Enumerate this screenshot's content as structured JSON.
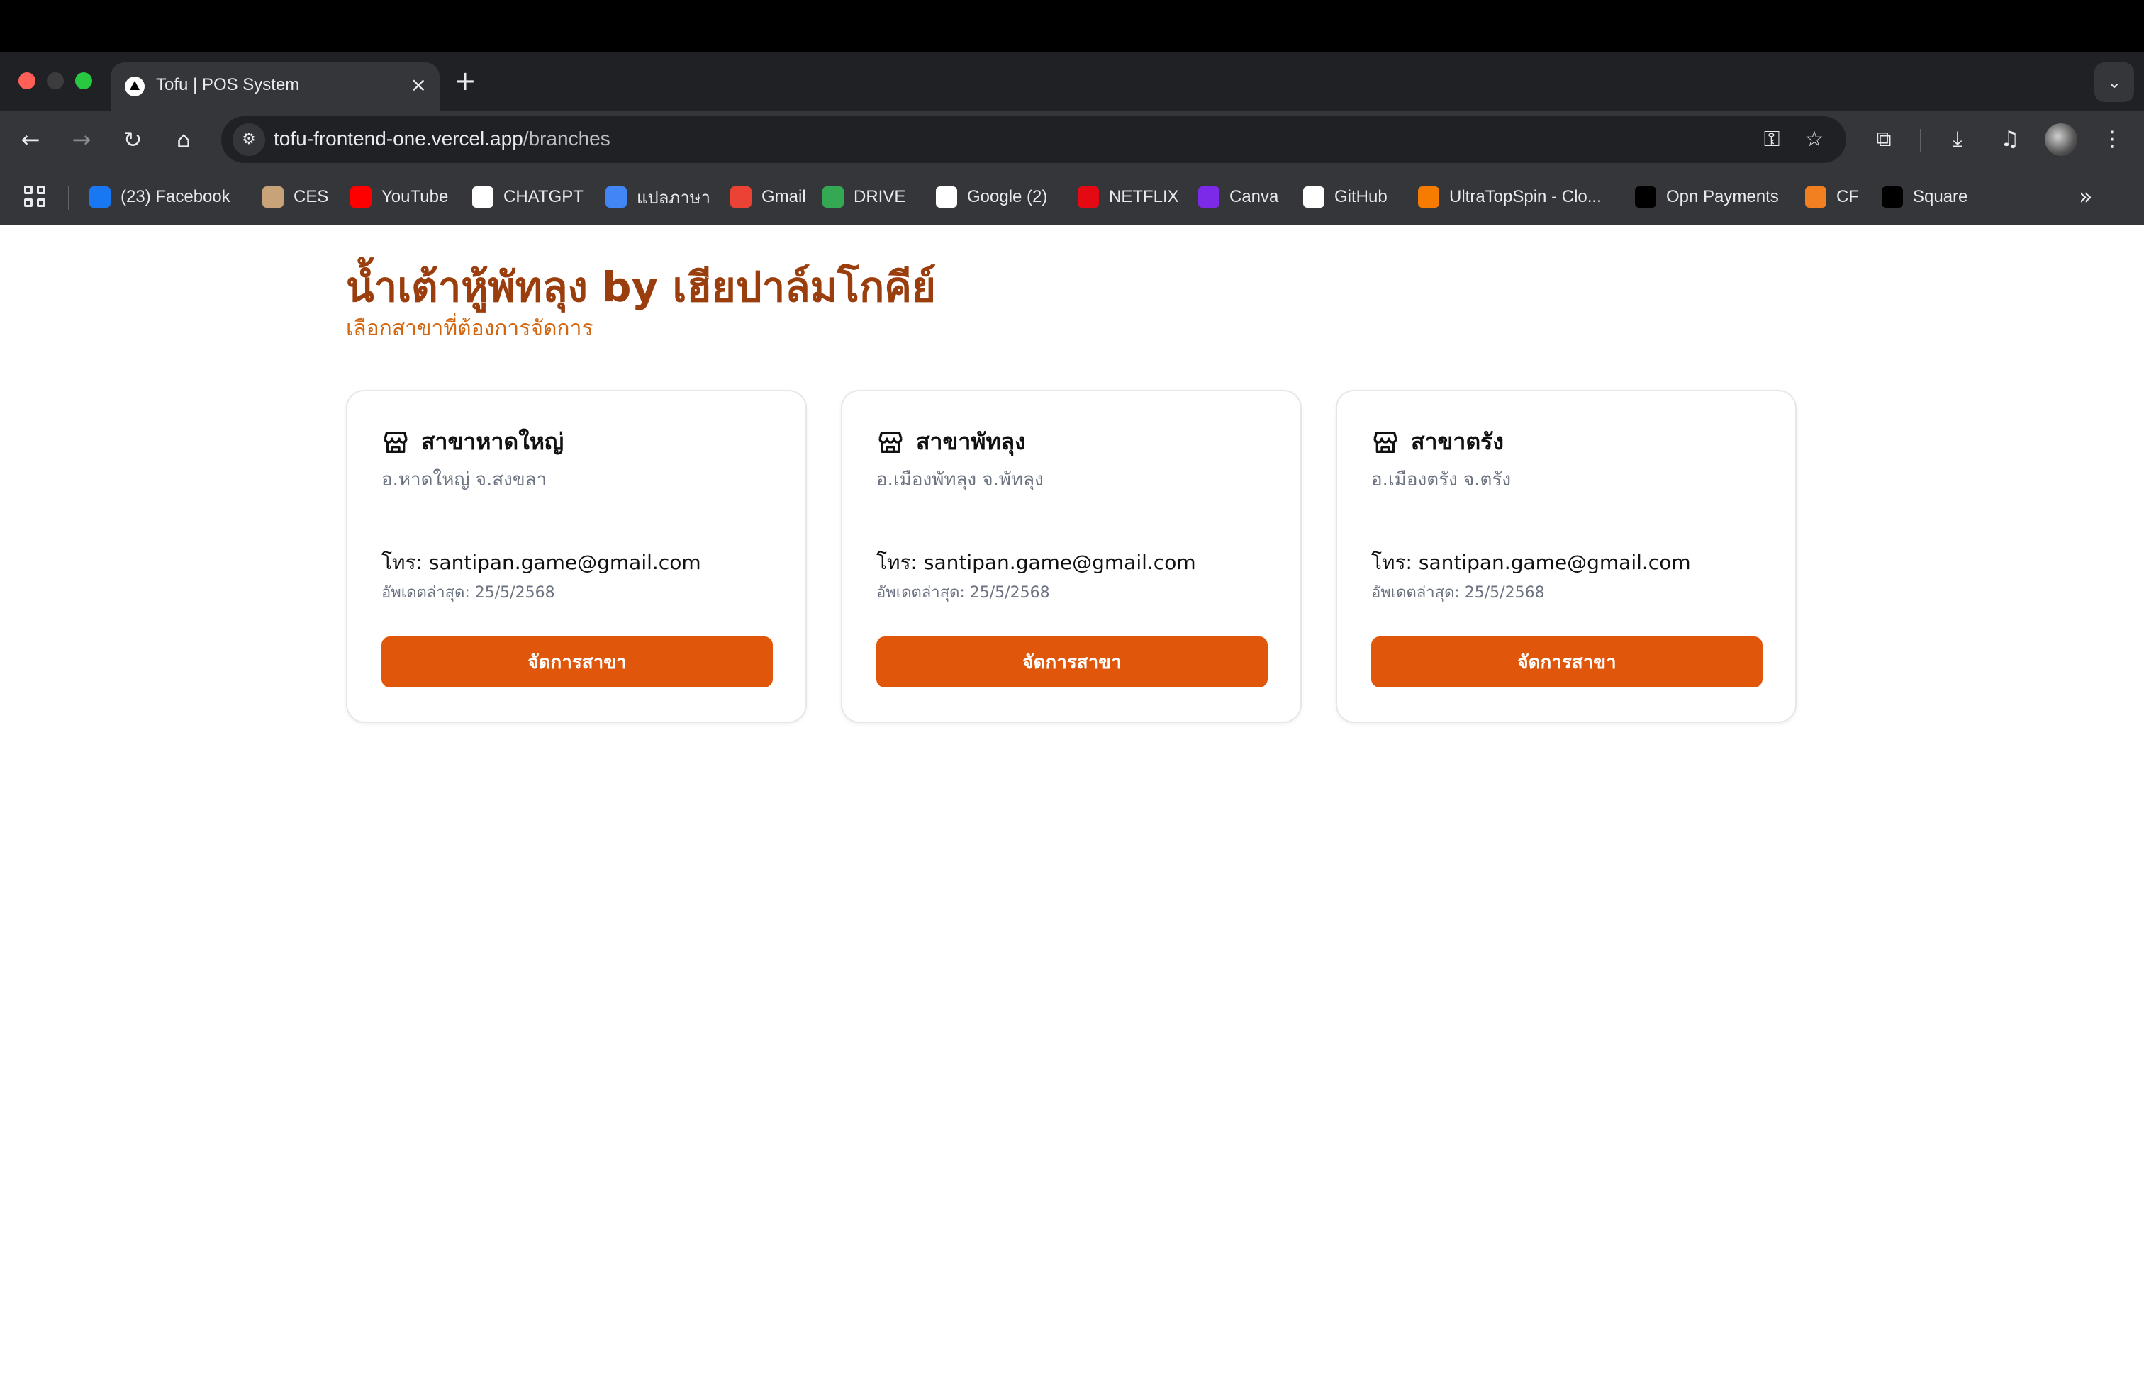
{
  "browser": {
    "tab_title": "Tofu | POS System",
    "tab_close": "×",
    "new_tab": "+",
    "url_host": "tofu-frontend-one.vercel.app",
    "url_path": "/branches"
  },
  "bookmarks": [
    {
      "label": "(23) Facebook",
      "icon": "facebook-icon",
      "color": "#1877f2"
    },
    {
      "label": "CES",
      "icon": "ces-icon",
      "color": "#c8a37a"
    },
    {
      "label": "YouTube",
      "icon": "youtube-icon",
      "color": "#ff0000"
    },
    {
      "label": "CHATGPT",
      "icon": "chatgpt-icon",
      "color": "#ffffff"
    },
    {
      "label": "แปลภาษา",
      "icon": "translate-icon",
      "color": "#4285f4"
    },
    {
      "label": "Gmail",
      "icon": "gmail-icon",
      "color": "#ea4335"
    },
    {
      "label": "DRIVE",
      "icon": "drive-icon",
      "color": "#34a853"
    },
    {
      "label": "Google (2)",
      "icon": "google-icon",
      "color": "#ffffff"
    },
    {
      "label": "NETFLIX",
      "icon": "netflix-icon",
      "color": "#e50914"
    },
    {
      "label": "Canva",
      "icon": "canva-icon",
      "color": "#7d2ae8"
    },
    {
      "label": "GitHub",
      "icon": "github-icon",
      "color": "#ffffff"
    },
    {
      "label": "UltraTopSpin - Clo...",
      "icon": "ultratopspin-icon",
      "color": "#f57c00"
    },
    {
      "label": "Opn Payments",
      "icon": "opn-icon",
      "color": "#000000"
    },
    {
      "label": "CF",
      "icon": "cloudflare-icon",
      "color": "#f38020"
    },
    {
      "label": "Square",
      "icon": "square-icon",
      "color": "#000000"
    }
  ],
  "page": {
    "title": "น้ำเต้าหู้พัทลุง by เฮียปาล์มโกคีย์",
    "subtitle": "เลือกสาขาที่ต้องการจัดการ",
    "colors": {
      "title": "#9a3e0e",
      "subtitle": "#d2650e",
      "button": "#e0560a"
    }
  },
  "branches": [
    {
      "name": "สาขาหาดใหญ่",
      "address": "อ.หาดใหญ่ จ.สงขลา",
      "contact": "โทร: santipan.game@gmail.com",
      "updated": "อัพเดตล่าสุด: 25/5/2568",
      "button": "จัดการสาขา"
    },
    {
      "name": "สาขาพัทลุง",
      "address": "อ.เมืองพัทลุง จ.พัทลุง",
      "contact": "โทร: santipan.game@gmail.com",
      "updated": "อัพเดตล่าสุด: 25/5/2568",
      "button": "จัดการสาขา"
    },
    {
      "name": "สาขาตรัง",
      "address": "อ.เมืองตรัง จ.ตรัง",
      "contact": "โทร: santipan.game@gmail.com",
      "updated": "อัพเดตล่าสุด: 25/5/2568",
      "button": "จัดการสาขา"
    }
  ]
}
